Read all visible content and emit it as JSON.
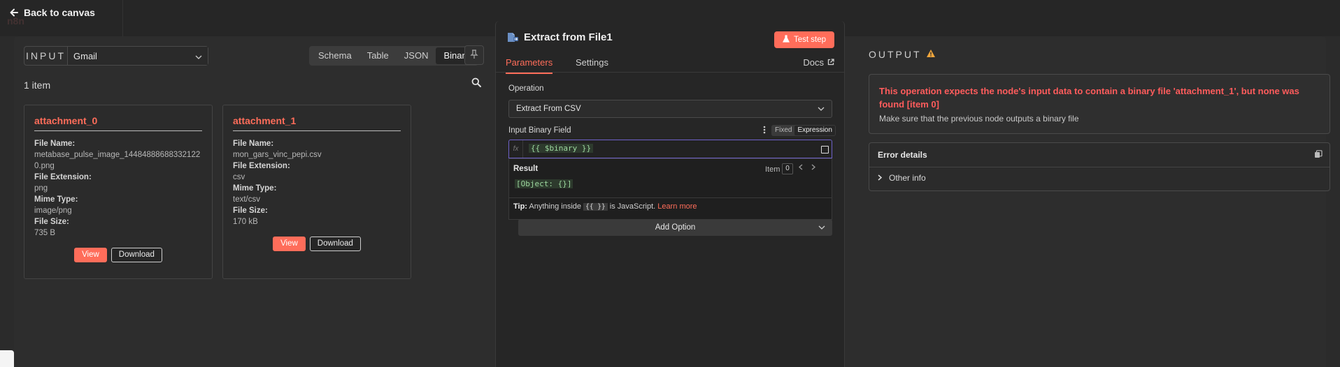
{
  "nav": {
    "back_label": "Back to canvas",
    "logo_text": "n8n"
  },
  "input": {
    "label": "INPUT",
    "source": "Gmail",
    "tabs": [
      "Schema",
      "Table",
      "JSON",
      "Binary"
    ],
    "active_tab": "Binary",
    "item_count": "1 item",
    "cards": [
      {
        "title": "attachment_0",
        "file_name_label": "File Name:",
        "file_name": "metabase_pulse_image_144848886883321220.png",
        "ext_label": "File Extension:",
        "ext": "png",
        "mime_label": "Mime Type:",
        "mime": "image/png",
        "size_label": "File Size:",
        "size": "735 B",
        "view_label": "View",
        "download_label": "Download"
      },
      {
        "title": "attachment_1",
        "file_name_label": "File Name:",
        "file_name": "mon_gars_vinc_pepi.csv",
        "ext_label": "File Extension:",
        "ext": "csv",
        "mime_label": "Mime Type:",
        "mime": "text/csv",
        "size_label": "File Size:",
        "size": "170 kB",
        "view_label": "View",
        "download_label": "Download"
      }
    ]
  },
  "node": {
    "title": "Extract from File1",
    "test_label": "Test step",
    "tabs": {
      "parameters": "Parameters",
      "settings": "Settings"
    },
    "docs_label": "Docs",
    "operation_label": "Operation",
    "operation_value": "Extract From CSV",
    "binary_field_label": "Input Binary Field",
    "mode_fixed": "Fixed",
    "mode_expression": "Expression",
    "fx_label": "fx",
    "expression": "{{ $binary }}",
    "result_label": "Result",
    "item_label": "Item",
    "item_index": "0",
    "result_value": "[Object: {}]",
    "tip_label": "Tip:",
    "tip_text_1": "Anything inside",
    "tip_code": "{{ }}",
    "tip_text_2": "is JavaScript.",
    "tip_link": "Learn more",
    "add_option_label": "Add Option"
  },
  "output": {
    "label": "OUTPUT",
    "error_message": "This operation expects the node's input data to contain a binary file 'attachment_1', but none was found [item 0]",
    "error_hint": "Make sure that the previous node outputs a binary file",
    "details_title": "Error details",
    "other_info": "Other info"
  },
  "colors": {
    "accent": "#ff6d5a",
    "error": "#ff5c5c",
    "warning": "#f0a63c",
    "expression_border": "#6e62c9"
  }
}
